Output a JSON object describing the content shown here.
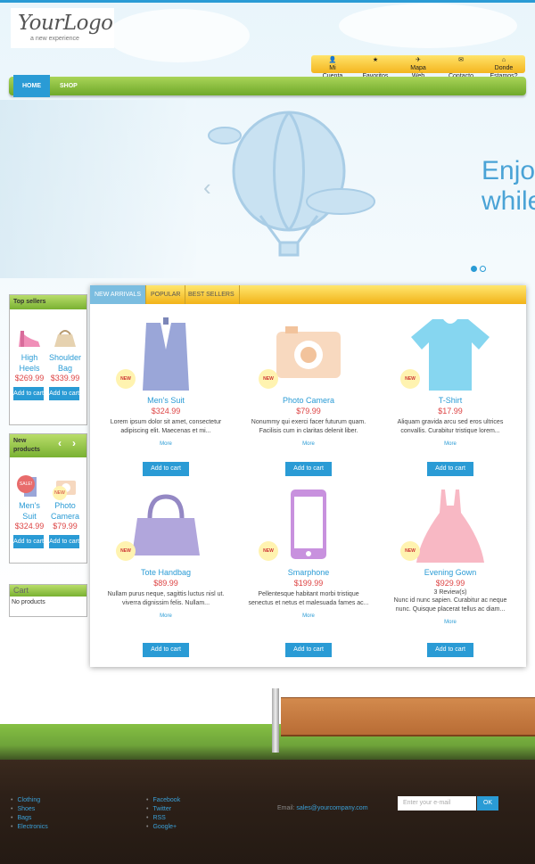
{
  "logo": {
    "main": "YourLogo",
    "tagline": "a new experience"
  },
  "top_links": [
    {
      "icon": "user-icon",
      "glyph": "👤",
      "line1": "Mi",
      "line2": "Cuenta"
    },
    {
      "icon": "star-icon",
      "glyph": "★",
      "line1": "",
      "line2": "Favoritos"
    },
    {
      "icon": "pin-icon",
      "glyph": "✈",
      "line1": "Mapa",
      "line2": "Web"
    },
    {
      "icon": "mail-icon",
      "glyph": "✉",
      "line1": "",
      "line2": "Contacto"
    },
    {
      "icon": "home-icon",
      "glyph": "⌂",
      "line1": "Donde",
      "line2": "Estamos?"
    }
  ],
  "nav": {
    "home": "HOME",
    "shop": "SHOP"
  },
  "slider": {
    "title_line1": "Enjoy",
    "title_line2": "while"
  },
  "sidebar": {
    "top_sellers": {
      "title": "Top sellers",
      "items": [
        {
          "name_line1": "High",
          "name_line2": "Heels",
          "price": "$269.99",
          "button": "Add to cart"
        },
        {
          "name_line1": "Shoulder",
          "name_line2": "Bag",
          "price": "$339.99",
          "button": "Add to cart"
        }
      ]
    },
    "new_products": {
      "title_line1": "New",
      "title_line2": "products",
      "items": [
        {
          "name_line1": "Men's",
          "name_line2": "Suit",
          "price": "$324.99",
          "button": "Add to cart",
          "badge": "SALE!"
        },
        {
          "name_line1": "Photo",
          "name_line2": "Camera",
          "price": "$79.99",
          "button": "Add to cart",
          "badge": "NEW"
        }
      ]
    },
    "cart": {
      "title": "Cart",
      "empty_text": "No products"
    }
  },
  "tabs": [
    "NEW ARRIVALS",
    "POPULAR",
    "BEST SELLERS"
  ],
  "products": [
    {
      "name": "Men's Suit",
      "price": "$324.99",
      "badge": "NEW",
      "reviews": "",
      "desc": "Lorem ipsum dolor sit amet, consectetur adipiscing elit. Maecenas et mi...",
      "more": "More",
      "button": "Add to cart"
    },
    {
      "name": "Photo Camera",
      "price": "$79.99",
      "badge": "NEW",
      "reviews": "",
      "desc": "Nonummy qui exerci facer futurum quam. Facilisis cum in claritas delenit liber.",
      "more": "More",
      "button": "Add to cart"
    },
    {
      "name": "T-Shirt",
      "price": "$17.99",
      "badge": "NEW",
      "reviews": "",
      "desc": "Aliquam gravida arcu sed eros ultrices convallis. Curabitur tristique lorem...",
      "more": "More",
      "button": "Add to cart"
    },
    {
      "name": "Tote Handbag",
      "price": "$89.99",
      "badge": "NEW",
      "reviews": "",
      "desc": "Nullam purus neque, sagittis luctus nisl ut. viverra dignissim felis. Nullam...",
      "more": "More",
      "button": "Add to cart"
    },
    {
      "name": "Smarphone",
      "price": "$199.99",
      "badge": "NEW",
      "reviews": "",
      "desc": "Pellentesque habitant morbi tristique senectus et netus et malesuada fames ac...",
      "more": "More",
      "button": "Add to cart"
    },
    {
      "name": "Evening Gown",
      "price": "$929.99",
      "badge": "NEW",
      "reviews": "3 Review(s)",
      "desc": "Nunc id nunc sapien. Curabitur ac neque nunc. Quisque placerat tellus ac diam...",
      "more": "More",
      "button": "Add to cart"
    }
  ],
  "footer": {
    "categories": [
      "Clothing",
      "Shoes",
      "Bags",
      "Electronics"
    ],
    "social": [
      "Facebook",
      "Twitter",
      "RSS",
      "Google+"
    ],
    "email_label": "Email:",
    "email": "sales@yourcompany.com",
    "newsletter_placeholder": "Enter your e-mail",
    "newsletter_button": "OK"
  },
  "colors": {
    "accent": "#2a9bd5",
    "nav_green": "#7fb535",
    "tab_yellow": "#f4c030",
    "price_red": "#d44444"
  }
}
